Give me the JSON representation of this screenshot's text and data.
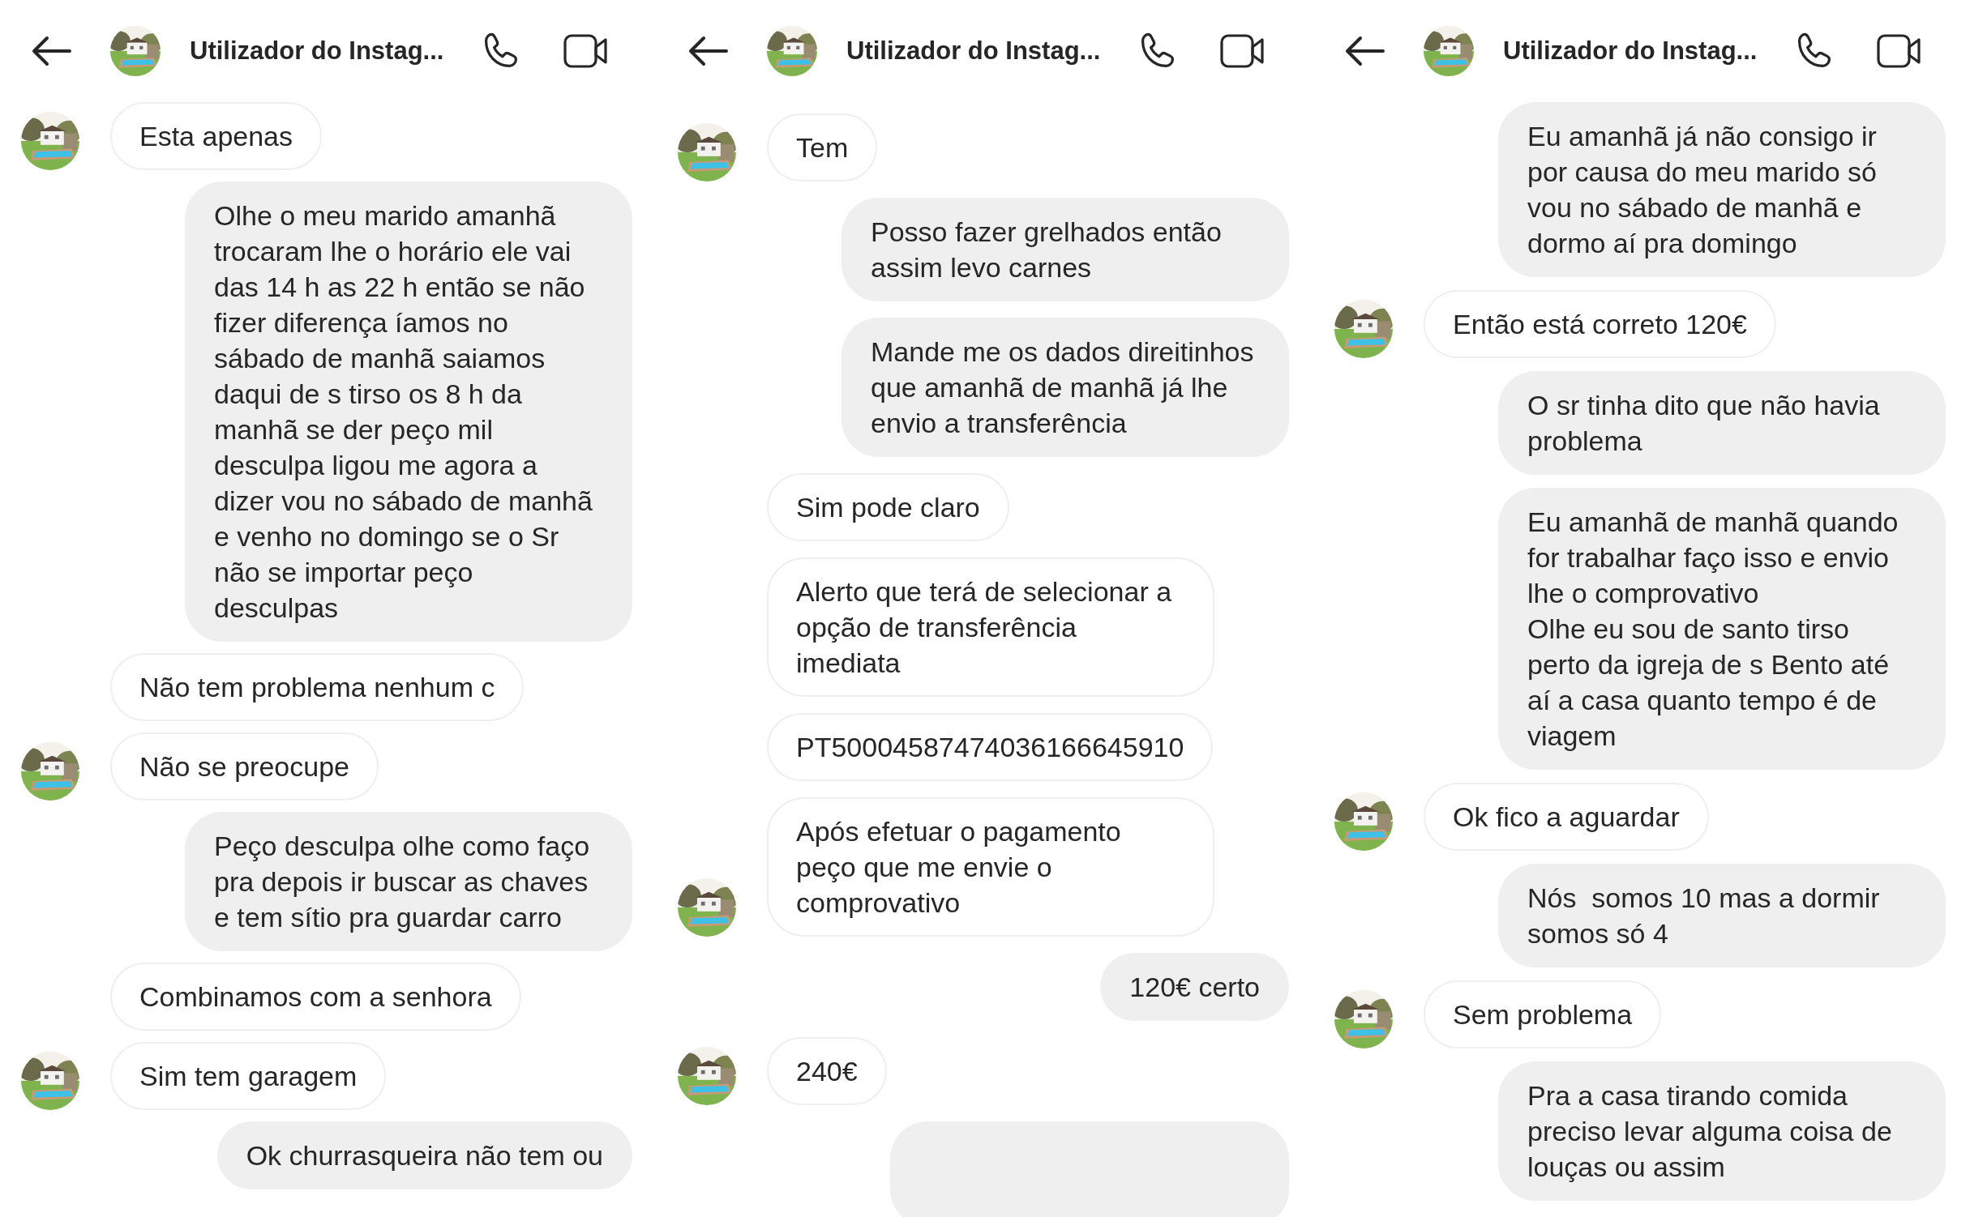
{
  "screens": [
    {
      "header": {
        "title": "Utilizador do Instag..."
      },
      "messages": [
        {
          "kind": "received",
          "avatar": true,
          "text": "Esta apenas"
        },
        {
          "kind": "sent",
          "text": "Olhe o meu marido amanhã trocaram lhe o horário ele vai das 14 h as 22 h então se não fizer diferença íamos no sábado de manhã saiamos daqui de s tirso os 8 h da manhã se der peço mil desculpa ligou me agora a dizer vou no sábado de manhã e venho no domingo se o Sr não se importar peço desculpas"
        },
        {
          "kind": "received",
          "avatar": false,
          "text": "Não tem problema nenhum c"
        },
        {
          "kind": "received",
          "avatar": true,
          "text": "Não se preocupe"
        },
        {
          "kind": "sent",
          "text": "Peço desculpa olhe como faço pra depois ir buscar as chaves e tem sítio pra guardar carro"
        },
        {
          "kind": "received",
          "avatar": false,
          "text": "Combinamos com a senhora"
        },
        {
          "kind": "received",
          "avatar": true,
          "text": "Sim tem garagem"
        },
        {
          "kind": "sent",
          "text": "Ok churrasqueira não tem ou"
        }
      ]
    },
    {
      "header": {
        "title": "Utilizador do Instag..."
      },
      "messages": [
        {
          "kind": "received",
          "avatar": true,
          "text": "Tem"
        },
        {
          "kind": "sent",
          "text": "Posso fazer grelhados então assim levo carnes"
        },
        {
          "kind": "sent",
          "text": "Mande me os dados direitinhos que amanhã de manhã já lhe envio a transferência"
        },
        {
          "kind": "received",
          "avatar": false,
          "text": "Sim pode claro"
        },
        {
          "kind": "received",
          "avatar": false,
          "text": "Alerto que terá de selecionar a opção de transferência imediata"
        },
        {
          "kind": "received",
          "avatar": false,
          "text": "PT50004587474036166645910"
        },
        {
          "kind": "received",
          "avatar": true,
          "text": "Após efetuar o pagamento peço que me envie o comprovativo"
        },
        {
          "kind": "sent",
          "text": "120€ certo"
        },
        {
          "kind": "received",
          "avatar": true,
          "text": "240€"
        },
        {
          "kind": "sent"
        }
      ]
    },
    {
      "header": {
        "title": "Utilizador do Instag..."
      },
      "messages": [
        {
          "kind": "sent",
          "text": "Eu amanhã já não consigo ir por causa do meu marido só vou no sábado de manhã e dormo aí pra domingo"
        },
        {
          "kind": "received",
          "avatar": true,
          "text": "Então está correto 120€"
        },
        {
          "kind": "sent",
          "text": "O sr tinha dito que não havia problema"
        },
        {
          "kind": "sent",
          "text": "Eu amanhã de manhã quando for trabalhar faço isso e envio lhe o comprovativo\nOlhe eu sou de santo tirso perto da igreja de s Bento até aí a casa quanto tempo é de viagem"
        },
        {
          "kind": "received",
          "avatar": true,
          "text": "Ok fico a aguardar"
        },
        {
          "kind": "sent",
          "text": "Nós  somos 10 mas a dormir somos só 4"
        },
        {
          "kind": "received",
          "avatar": true,
          "text": "Sem problema"
        },
        {
          "kind": "sent",
          "text": "Pra a casa tirando comida preciso levar alguma coisa de louças ou assim"
        }
      ]
    }
  ]
}
